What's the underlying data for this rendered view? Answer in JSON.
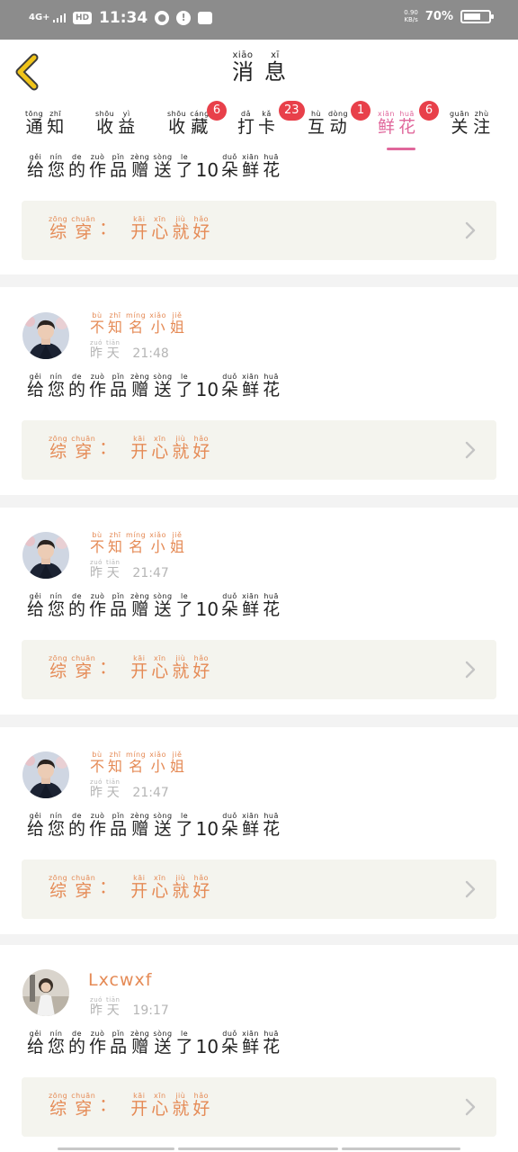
{
  "status_bar": {
    "network": "4G+",
    "hd": "HD",
    "time": "11:34",
    "speed_top": "0.90",
    "speed_bottom": "KB/s",
    "battery_text": "70%",
    "battery_level": 0.7
  },
  "header": {
    "title": [
      {
        "py": "xiāo",
        "hz": "消"
      },
      {
        "py": "xī",
        "hz": "息"
      }
    ]
  },
  "tabs": [
    {
      "chars": [
        {
          "py": "tōng",
          "hz": "通"
        },
        {
          "py": "zhī",
          "hz": "知"
        }
      ],
      "badge": ""
    },
    {
      "chars": [
        {
          "py": "shōu",
          "hz": "收"
        },
        {
          "py": "yì",
          "hz": "益"
        }
      ],
      "badge": ""
    },
    {
      "chars": [
        {
          "py": "shōu",
          "hz": "收"
        },
        {
          "py": "cáng",
          "hz": "藏"
        }
      ],
      "badge": "6"
    },
    {
      "chars": [
        {
          "py": "dǎ",
          "hz": "打"
        },
        {
          "py": "kǎ",
          "hz": "卡"
        }
      ],
      "badge": "23"
    },
    {
      "chars": [
        {
          "py": "hù",
          "hz": "互"
        },
        {
          "py": "dòng",
          "hz": "动"
        }
      ],
      "badge": "1"
    },
    {
      "chars": [
        {
          "py": "xiān",
          "hz": "鲜"
        },
        {
          "py": "huā",
          "hz": "花"
        }
      ],
      "badge": "6",
      "active": true
    },
    {
      "chars": [
        {
          "py": "guān",
          "hz": "关"
        },
        {
          "py": "zhù",
          "hz": "注"
        }
      ],
      "badge": ""
    }
  ],
  "message_parts": {
    "before": [
      {
        "py": "gěi",
        "hz": "给"
      },
      {
        "py": "nín",
        "hz": "您"
      },
      {
        "py": "de",
        "hz": "的"
      },
      {
        "py": "zuò",
        "hz": "作"
      },
      {
        "py": "pǐn",
        "hz": "品"
      },
      {
        "py": "zèng",
        "hz": "赠"
      },
      {
        "py": "sòng",
        "hz": "送"
      },
      {
        "py": "le",
        "hz": "了"
      }
    ],
    "count": "10",
    "after": [
      {
        "py": "duǒ",
        "hz": "朵"
      },
      {
        "py": "xiān",
        "hz": "鲜"
      },
      {
        "py": "huā",
        "hz": "花"
      }
    ]
  },
  "work_label": [
    {
      "py": "zōng",
      "hz": "综"
    },
    {
      "py": "chuān",
      "hz": "穿"
    }
  ],
  "work_colon": "：",
  "work_title": [
    {
      "py": "kāi",
      "hz": "开"
    },
    {
      "py": "xīn",
      "hz": "心"
    },
    {
      "py": "jiù",
      "hz": "就"
    },
    {
      "py": "hǎo",
      "hz": "好"
    }
  ],
  "notifications": [
    {
      "partial": true,
      "user_chars": [],
      "user_latin": "",
      "day": [],
      "time": ""
    },
    {
      "partial": false,
      "avatar": "man",
      "user_chars": [
        {
          "py": "bù",
          "hz": "不"
        },
        {
          "py": "zhī",
          "hz": "知"
        },
        {
          "py": "míng",
          "hz": "名"
        },
        {
          "py": "xiǎo",
          "hz": "小"
        },
        {
          "py": "jiě",
          "hz": "姐"
        }
      ],
      "user_latin": "",
      "day": [
        {
          "py": "zuó",
          "hz": "昨"
        },
        {
          "py": "tiān",
          "hz": "天"
        }
      ],
      "time": "21:48"
    },
    {
      "partial": false,
      "avatar": "man",
      "user_chars": [
        {
          "py": "bù",
          "hz": "不"
        },
        {
          "py": "zhī",
          "hz": "知"
        },
        {
          "py": "míng",
          "hz": "名"
        },
        {
          "py": "xiǎo",
          "hz": "小"
        },
        {
          "py": "jiě",
          "hz": "姐"
        }
      ],
      "user_latin": "",
      "day": [
        {
          "py": "zuó",
          "hz": "昨"
        },
        {
          "py": "tiān",
          "hz": "天"
        }
      ],
      "time": "21:47"
    },
    {
      "partial": false,
      "avatar": "man",
      "user_chars": [
        {
          "py": "bù",
          "hz": "不"
        },
        {
          "py": "zhī",
          "hz": "知"
        },
        {
          "py": "míng",
          "hz": "名"
        },
        {
          "py": "xiǎo",
          "hz": "小"
        },
        {
          "py": "jiě",
          "hz": "姐"
        }
      ],
      "user_latin": "",
      "day": [
        {
          "py": "zuó",
          "hz": "昨"
        },
        {
          "py": "tiān",
          "hz": "天"
        }
      ],
      "time": "21:47"
    },
    {
      "partial": false,
      "avatar": "girl",
      "user_chars": [],
      "user_latin": "Lxcwxf",
      "day": [
        {
          "py": "zuó",
          "hz": "昨"
        },
        {
          "py": "tiān",
          "hz": "天"
        }
      ],
      "time": "19:17"
    }
  ],
  "icons": {
    "back": "back-chevron-icon",
    "item_arrow": "chevron-right-icon"
  },
  "colors": {
    "accent_pink": "#e0679b",
    "badge_red": "#e8404a",
    "orange_text": "#e58a55",
    "card_bg": "#f4f4ee",
    "back_icon": "#f0c419"
  }
}
